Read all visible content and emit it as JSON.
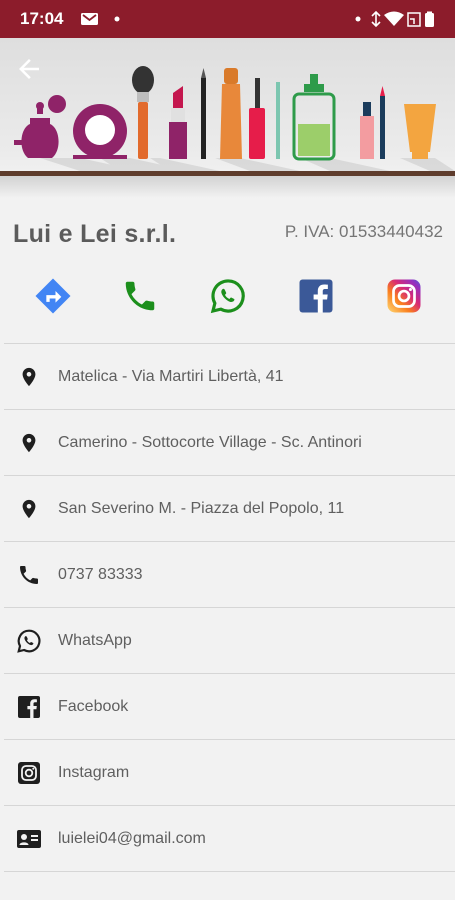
{
  "status_bar": {
    "time": "17:04"
  },
  "header": {
    "banner_icons": [
      "perfume-bottle",
      "compact-mirror",
      "makeup-brush",
      "lipstick",
      "eyeliner",
      "mascara",
      "nail-polish",
      "lotion-pump",
      "lip-gloss",
      "cream-tube"
    ]
  },
  "company": {
    "name": "Lui e Lei s.r.l.",
    "vat": "P. IVA: 01533440432"
  },
  "actions": [
    {
      "icon": "directions-icon",
      "color": "#4285f4"
    },
    {
      "icon": "phone-icon",
      "color": "#1c8f1c"
    },
    {
      "icon": "whatsapp-icon",
      "color": "#1c8f1c"
    },
    {
      "icon": "facebook-icon",
      "color": "#3b5998"
    },
    {
      "icon": "instagram-icon",
      "color": "#c13584"
    }
  ],
  "contacts": [
    {
      "icon": "location-pin-icon",
      "label": "Matelica - Via Martiri Libertà, 41"
    },
    {
      "icon": "location-pin-icon",
      "label": "Camerino - Sottocorte Village - Sc. Antinori"
    },
    {
      "icon": "location-pin-icon",
      "label": "San Severino M. - Piazza del Popolo, 11"
    },
    {
      "icon": "phone-icon",
      "label": "0737 83333"
    },
    {
      "icon": "whatsapp-icon",
      "label": "WhatsApp"
    },
    {
      "icon": "facebook-icon",
      "label": "Facebook"
    },
    {
      "icon": "instagram-icon",
      "label": "Instagram"
    },
    {
      "icon": "contact-card-icon",
      "label": "luielei04@gmail.com"
    }
  ],
  "colors": {
    "status_bar": "#8c1c2b",
    "background": "#f2f2f2",
    "title_text": "#5b5b5b",
    "body_text": "#5f5f5f"
  }
}
